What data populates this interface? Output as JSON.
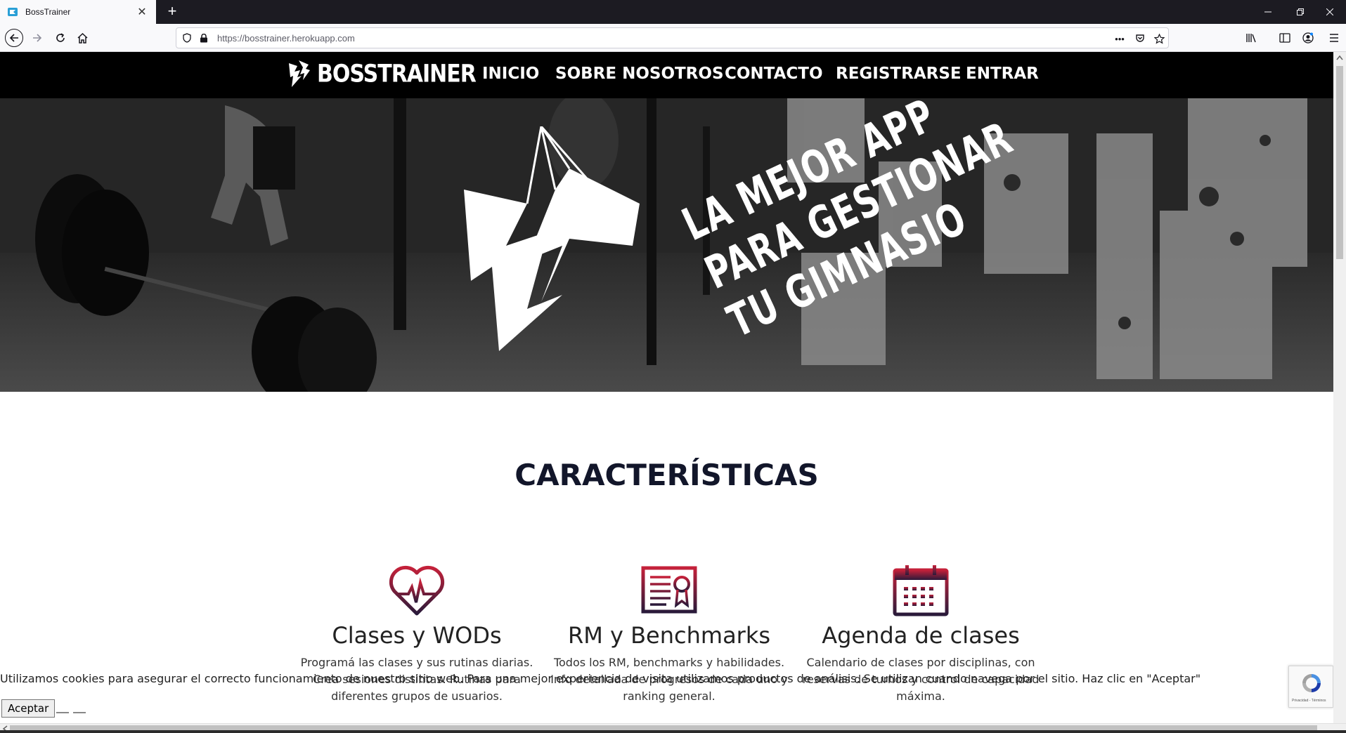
{
  "browser": {
    "tab_title": "BossTrainer",
    "url": "https://bosstrainer.herokuapp.com",
    "new_tab_symbol": "+",
    "close_symbol": "✕"
  },
  "site": {
    "logo_text": "BOSSTRAINER",
    "menu": [
      "INICIO",
      "SOBRE NOSOTROS",
      "CONTACTO",
      "REGISTRARSE",
      "ENTRAR"
    ]
  },
  "hero": {
    "headline": [
      "LA MEJOR APP",
      "PARA GESTIONAR",
      "TU GIMNASIO"
    ]
  },
  "features": {
    "section_title": "CARACTERÍSTICAS",
    "items": [
      {
        "icon": "heart-pulse-icon",
        "title": "Clases y WODs",
        "desc": "Programá las clases y sus rutinas diarias. Crea sesiones distintas. Rutinas para diferentes grupos de usuarios."
      },
      {
        "icon": "certificate-icon",
        "title": "RM y Benchmarks",
        "desc": "Todos los RM, benchmarks y habilidades. Info detallada de progresos de cada uno y ranking general."
      },
      {
        "icon": "calendar-icon",
        "title": "Agenda de clases",
        "desc": "Calendario de clases por disciplinas, con reservas de turnos y control de capacidad máxima."
      }
    ]
  },
  "cookie": {
    "text": "Utilizamos cookies para asegurar el correcto funcionamiento de nuestro sitio web. Para una mejor experiencia de visita utilizamos productos de análisis. Se utilizan cuando navega por el sitio. Haz clic en \"Aceptar\"",
    "accept_label": "Aceptar"
  },
  "recaptcha": {
    "label": "Privacidad - Términos"
  },
  "colors": {
    "icon_gradient_top": "#c4213a",
    "icon_gradient_bottom": "#2a1a3a",
    "title": "#12162a"
  }
}
